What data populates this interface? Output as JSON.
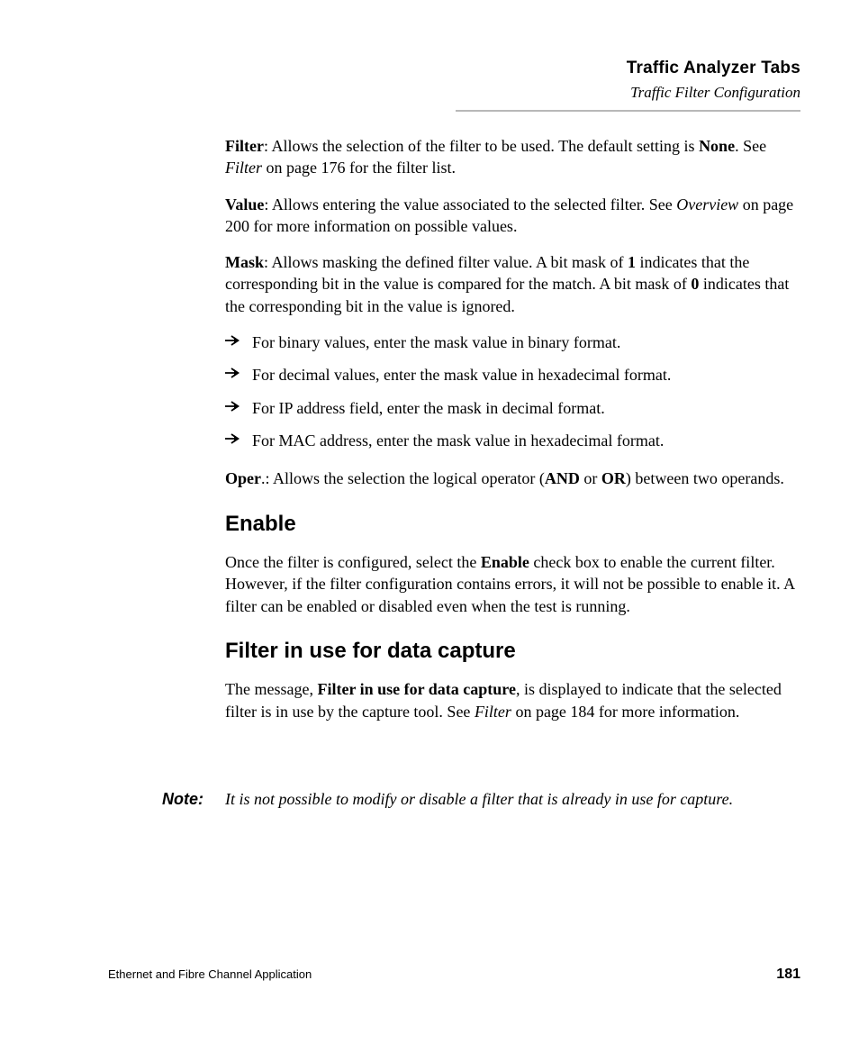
{
  "header": {
    "title": "Traffic Analyzer Tabs",
    "subtitle": "Traffic Filter Configuration"
  },
  "filter": {
    "label": "Filter",
    "text1": ": Allows the selection of the filter to be used. The default setting is ",
    "none": "None",
    "text2": ". See ",
    "ref": "Filter",
    "text3": " on page 176 for the filter list."
  },
  "value": {
    "label": "Value",
    "text1": ": Allows entering the value associated to the selected filter. See ",
    "ref": "Overview",
    "text2": " on page 200 for more information on possible values."
  },
  "mask": {
    "label": "Mask",
    "text1": ": Allows masking the defined filter value. A bit mask of ",
    "one": "1",
    "text2": " indicates that the corresponding bit in the value is compared for the match. A bit mask of ",
    "zero": "0",
    "text3": " indicates that the corresponding bit in the value is ignored."
  },
  "bullets": {
    "b1": "For binary values, enter the mask value in binary format.",
    "b2": "For decimal values, enter the mask value in hexadecimal format.",
    "b3": "For IP address field, enter the mask in decimal format.",
    "b4": "For MAC address, enter the mask value in hexadecimal format."
  },
  "oper": {
    "label": "Oper",
    "text1": ".: Allows the selection the logical operator (",
    "and": "AND",
    "text2": " or ",
    "or": "OR",
    "text3": ") between two operands."
  },
  "enable": {
    "heading": "Enable",
    "text1": "Once the filter is configured, select the ",
    "bold": "Enable",
    "text2": " check box to enable the current filter. However, if the filter configuration contains errors, it will not be possible to enable it. A filter can be enabled or disabled even when the test is running."
  },
  "capture": {
    "heading": "Filter in use for data capture",
    "text1": "The message, ",
    "bold": "Filter in use for data capture",
    "text2": ", is displayed to indicate that the selected filter is in use by the capture tool. See ",
    "ref": "Filter",
    "text3": " on page 184 for more information."
  },
  "note": {
    "label": "Note:",
    "body": "It is not possible to modify or disable a filter that is already in use for capture."
  },
  "footer": {
    "left": "Ethernet and Fibre Channel Application",
    "right": "181"
  }
}
